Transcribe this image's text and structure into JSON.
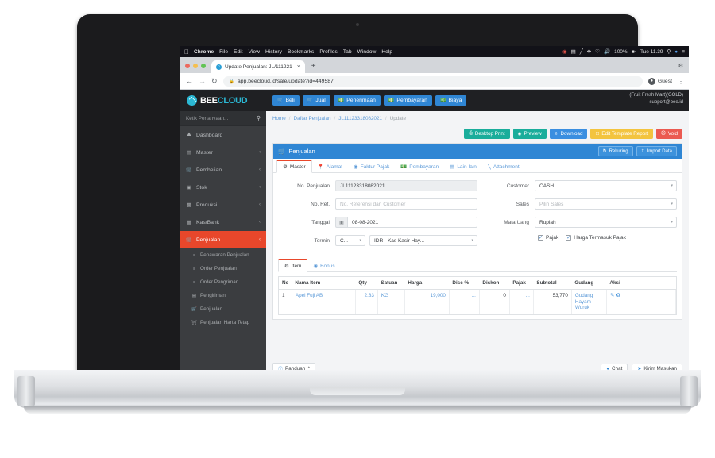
{
  "macos_menubar": {
    "apple_icon": "apple-icon",
    "items": [
      "Chrome",
      "File",
      "Edit",
      "View",
      "History",
      "Bookmarks",
      "Profiles",
      "Tab",
      "Window",
      "Help"
    ],
    "status_icons": [
      "record-icon",
      "screen-icon",
      "pencil-icon",
      "bluetooth-icon",
      "wifi-icon",
      "volume-icon"
    ],
    "battery_percent": "100%",
    "battery_icon": "battery-icon",
    "clock": "Tue 11.39",
    "search_icon": "spotlight-search-icon",
    "account_icon": "account-icon",
    "control_center_icon": "control-center-icon"
  },
  "browser": {
    "tab": {
      "title": "Update Penjualan: JL/111221",
      "favicon": "beecloud-favicon",
      "close_icon": "close-icon"
    },
    "new_tab_icon": "plus-icon",
    "tabstrip_right_icon": "settings-icon",
    "back_icon": "arrow-left-icon",
    "forward_icon": "arrow-right-icon",
    "reload_icon": "reload-icon",
    "lock_icon": "lock-icon",
    "url": "app.beecloud.id/sale/update?id=449587",
    "profile_label": "Guest",
    "profile_icon": "user-icon",
    "menu_icon": "kebab-menu-icon"
  },
  "app_header": {
    "logo_bee": "BEE",
    "logo_cloud": "CLOUD",
    "nav": [
      {
        "label": "Beli",
        "icon": "cart-icon"
      },
      {
        "label": "Jual",
        "icon": "cart-icon"
      },
      {
        "label": "Penerimaan",
        "icon": "money-icon"
      },
      {
        "label": "Pembayaran",
        "icon": "money-icon"
      },
      {
        "label": "Biaya",
        "icon": "money-icon"
      }
    ],
    "account_company": "(Fruit Fresh Mart)(GOLD)",
    "account_email": "support@bee.id"
  },
  "sidebar": {
    "search_placeholder": "Ketik Pertanyaan...",
    "search_icon": "search-icon",
    "items": [
      {
        "label": "Dashboard",
        "icon": "home-icon",
        "chevron": "",
        "active": false
      },
      {
        "label": "Master",
        "icon": "grid-icon",
        "chevron": "‹",
        "active": false
      },
      {
        "label": "Pembelian",
        "icon": "cart-icon",
        "chevron": "‹",
        "active": false
      },
      {
        "label": "Stok",
        "icon": "box-icon",
        "chevron": "‹",
        "active": false
      },
      {
        "label": "Produksi",
        "icon": "chart-icon",
        "chevron": "‹",
        "active": false
      },
      {
        "label": "Kas/Bank",
        "icon": "bank-icon",
        "chevron": "‹",
        "active": false
      },
      {
        "label": "Penjualan",
        "icon": "cart-icon",
        "chevron": "‹",
        "active": true
      }
    ],
    "subitems": [
      {
        "label": "Penawaran Penjualan",
        "icon": "list-icon"
      },
      {
        "label": "Order Penjualan",
        "icon": "list-icon"
      },
      {
        "label": "Order Pengriman",
        "icon": "list-icon"
      },
      {
        "label": "Pengiriman",
        "icon": "truck-icon"
      },
      {
        "label": "Penjualan",
        "icon": "cart-icon"
      },
      {
        "label": "Penjualan Harta Tetap",
        "icon": "asset-icon"
      }
    ]
  },
  "breadcrumb": {
    "home": "Home",
    "list": "Daftar Penjualan",
    "doc": "JL11123318082021",
    "current": "Update",
    "separator": "/"
  },
  "action_bar": [
    {
      "label": "Desktop Print",
      "icon": "printer-icon",
      "color": "#1aad9b"
    },
    {
      "label": "Preview",
      "icon": "eye-icon",
      "color": "#1aad9b"
    },
    {
      "label": "Download",
      "icon": "download-icon",
      "color": "#3a8ee0"
    },
    {
      "label": "Edit Template Report",
      "icon": "file-icon",
      "color": "#f3c43f"
    },
    {
      "label": "Void",
      "icon": "ban-icon",
      "color": "#eb5a51"
    }
  ],
  "panel": {
    "title": "Penjualan",
    "title_icon": "cart-icon",
    "buttons": [
      {
        "label": "Rekuring",
        "icon": "refresh-icon"
      },
      {
        "label": "Import Data",
        "icon": "upload-icon"
      }
    ],
    "tabs": [
      {
        "label": "Master",
        "icon": "gears-icon",
        "active": true
      },
      {
        "label": "Alamat",
        "icon": "pin-icon",
        "active": false
      },
      {
        "label": "Faktur Pajak",
        "icon": "receipt-icon",
        "active": false
      },
      {
        "label": "Pembayaran",
        "icon": "money-icon",
        "active": false
      },
      {
        "label": "Lain-lain",
        "icon": "book-icon",
        "active": false
      },
      {
        "label": "Attachment",
        "icon": "paperclip-icon",
        "active": false
      }
    ]
  },
  "form": {
    "left": {
      "no_penjualan_label": "No. Penjualan",
      "no_penjualan_value": "JL11123318082021",
      "no_ref_label": "No. Ref.",
      "no_ref_placeholder": "No. Referensi dari Customer",
      "no_ref_value": "",
      "tanggal_label": "Tanggal",
      "tanggal_value": "08-08-2021",
      "calendar_icon": "calendar-icon",
      "termin_label": "Termin",
      "termin_value": "C...",
      "termin_account_value": "IDR - Kas Kasir Hay..."
    },
    "right": {
      "customer_label": "Customer",
      "customer_value": "CASH",
      "sales_label": "Sales",
      "sales_placeholder": "Pilih Sales",
      "mata_uang_label": "Mata Uang",
      "mata_uang_value": "Rupiah",
      "pajak_label": "Pajak",
      "pajak_checked": true,
      "harga_termasuk_pajak_label": "Harga Termasuk Pajak",
      "harga_termasuk_pajak_checked": true,
      "check_mark": "✓"
    }
  },
  "item_section": {
    "tabs": [
      {
        "label": "Item",
        "icon": "item-icon",
        "active": true
      },
      {
        "label": "Bonus",
        "icon": "gift-icon",
        "active": false
      }
    ],
    "columns": [
      "No",
      "Nama Item",
      "Qty",
      "Satuan",
      "Harga",
      "Disc %",
      "Diskon",
      "Pajak",
      "Subtotal",
      "Gudang",
      "Aksi"
    ],
    "rows": [
      {
        "no": "1",
        "nama_item": "Apel Fuji AB",
        "qty": "2.83",
        "satuan": "KG",
        "harga": "19,000",
        "disc_persen": "...",
        "diskon": "0",
        "pajak": "...",
        "subtotal": "53,770",
        "gudang": "Gudang Hayam Wuruk",
        "aksi_edit_icon": "pencil-icon",
        "aksi_delete_icon": "trash-icon"
      }
    ]
  },
  "footer": {
    "panduan_label": "Panduan",
    "panduan_icon": "info-icon",
    "panduan_caret": "^",
    "chat_label": "Chat",
    "chat_icon": "chat-icon",
    "kirim_label": "Kirim Masukan",
    "kirim_icon": "send-icon"
  }
}
